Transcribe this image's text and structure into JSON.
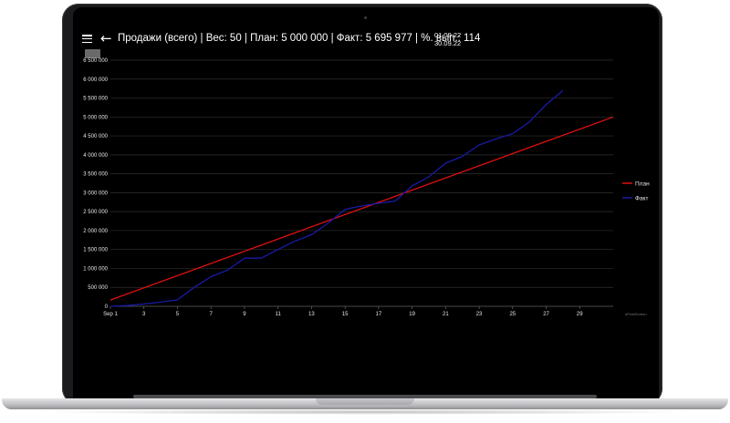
{
  "appbar": {
    "menu_icon": "menu-icon",
    "back_icon": "arrow-left-icon",
    "title": "Продажи (всего) | Вес: 50 | План: 5 000 000 | Факт: 5 695 977 | %. вып.: 114",
    "date_from": "01.09.22",
    "date_to": "30.09.22"
  },
  "watermark": "#PixelScreen",
  "colors": {
    "plan": "#e01010",
    "fact": "#1a1aa8",
    "grid": "#2f2f2f",
    "background": "#000000"
  },
  "chart_data": {
    "type": "line",
    "ylim": [
      0,
      6500000
    ],
    "xlim": [
      1,
      31
    ],
    "y_ticks": [
      "0",
      "500 000",
      "1 000 000",
      "1 500 000",
      "2 000 000",
      "2 500 000",
      "3 000 000",
      "3 500 000",
      "4 000 000",
      "4 500 000",
      "5 000 000",
      "5 500 000",
      "6 000 000",
      "6 500 000"
    ],
    "y_tick_values": [
      0,
      500000,
      1000000,
      1500000,
      2000000,
      2500000,
      3000000,
      3500000,
      4000000,
      4500000,
      5000000,
      5500000,
      6000000,
      6500000
    ],
    "x_ticks": [
      "Sep 1",
      "3",
      "5",
      "7",
      "9",
      "11",
      "13",
      "15",
      "17",
      "19",
      "21",
      "23",
      "25",
      "27",
      "29"
    ],
    "x_tick_values": [
      1,
      3,
      5,
      7,
      9,
      11,
      13,
      15,
      17,
      19,
      21,
      23,
      25,
      27,
      29
    ],
    "legend_position": "right",
    "series": [
      {
        "name": "План",
        "color": "#e01010",
        "x": [
          1,
          31
        ],
        "y": [
          166667,
          5000000
        ]
      },
      {
        "name": "Факт",
        "color": "#1a1aa8",
        "x": [
          1,
          2,
          3,
          4,
          5,
          6,
          7,
          8,
          9,
          10,
          11,
          12,
          13,
          14,
          15,
          16,
          17,
          18,
          19,
          20,
          21,
          22,
          23,
          24,
          25,
          26,
          27,
          28
        ],
        "y": [
          0,
          20000,
          60000,
          110000,
          170000,
          500000,
          780000,
          960000,
          1270000,
          1270000,
          1500000,
          1720000,
          1890000,
          2200000,
          2560000,
          2650000,
          2720000,
          2780000,
          3180000,
          3420000,
          3780000,
          3960000,
          4260000,
          4420000,
          4560000,
          4870000,
          5330000,
          5696000
        ]
      }
    ]
  }
}
